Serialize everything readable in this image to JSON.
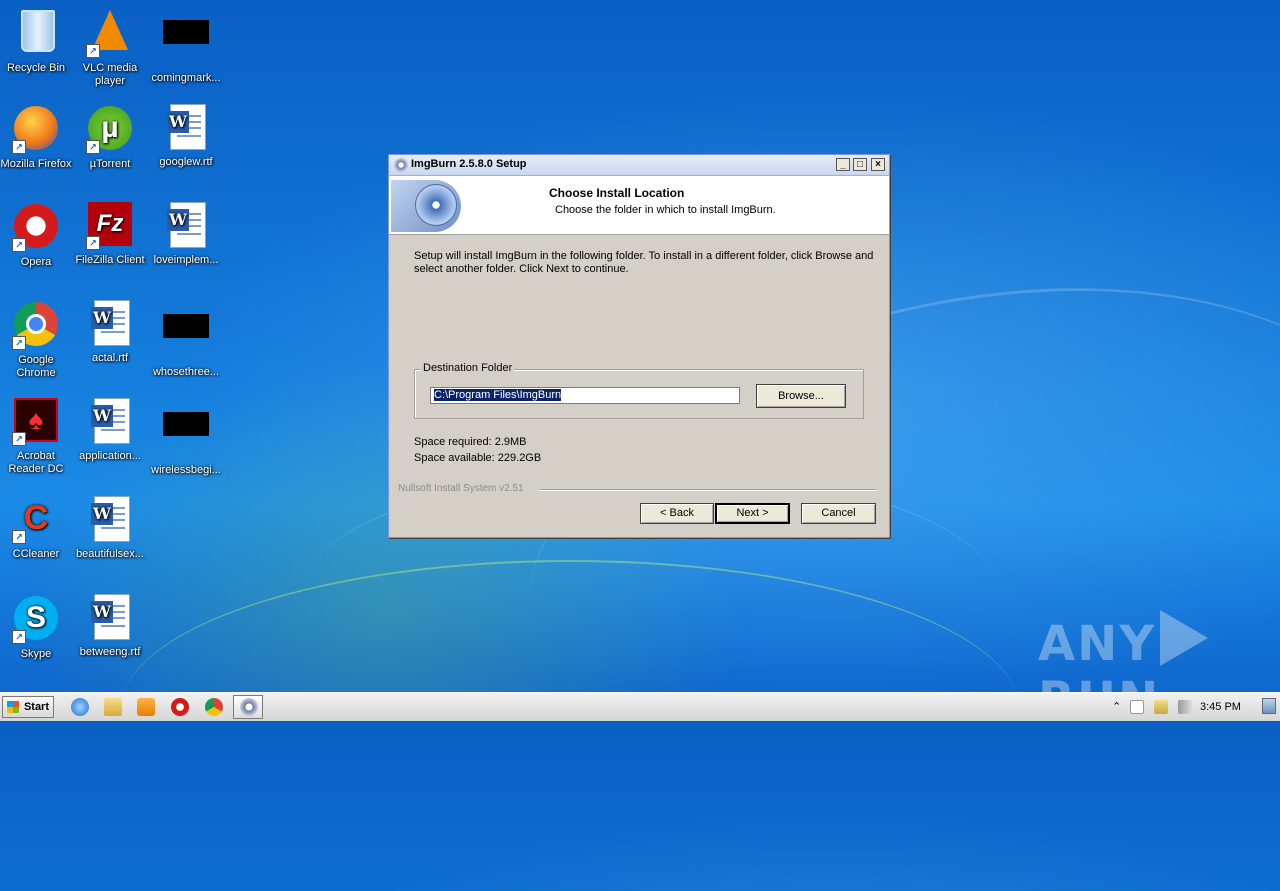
{
  "desktop": {
    "icons": [
      {
        "label": "Recycle Bin"
      },
      {
        "label": "VLC media player"
      },
      {
        "label": "comingmark..."
      },
      {
        "label": "Mozilla Firefox"
      },
      {
        "label": "µTorrent"
      },
      {
        "label": "googlew.rtf"
      },
      {
        "label": "Opera"
      },
      {
        "label": "FileZilla Client"
      },
      {
        "label": "loveimplem..."
      },
      {
        "label": "Google Chrome"
      },
      {
        "label": "actal.rtf"
      },
      {
        "label": "whosethree..."
      },
      {
        "label": "Acrobat Reader DC"
      },
      {
        "label": "application..."
      },
      {
        "label": "wirelessbegi..."
      },
      {
        "label": "CCleaner"
      },
      {
        "label": "beautifulsex..."
      },
      {
        "label": "Skype"
      },
      {
        "label": "betweeng.rtf"
      }
    ]
  },
  "dialog": {
    "title": "ImgBurn 2.5.8.0 Setup",
    "header_title": "Choose Install Location",
    "header_subtitle": "Choose the folder in which to install ImgBurn.",
    "intro": "Setup will install ImgBurn in the following folder. To install in a different folder, click Browse and select another folder. Click Next to continue.",
    "group_label": "Destination Folder",
    "destination_value": "C:\\Program Files\\ImgBurn",
    "browse_label": "Browse...",
    "space_required": "Space required: 2.9MB",
    "space_available": "Space available: 229.2GB",
    "branding": "Nullsoft Install System v2.51",
    "back_label": "< Back",
    "next_label": "Next >",
    "cancel_label": "Cancel",
    "min_glyph": "_",
    "max_glyph": "□",
    "close_glyph": "×"
  },
  "taskbar": {
    "start_label": "Start",
    "clock": "3:45 PM",
    "tray_up_glyph": "⌃"
  },
  "watermark": {
    "left": "ANY",
    "right": "RUN"
  }
}
